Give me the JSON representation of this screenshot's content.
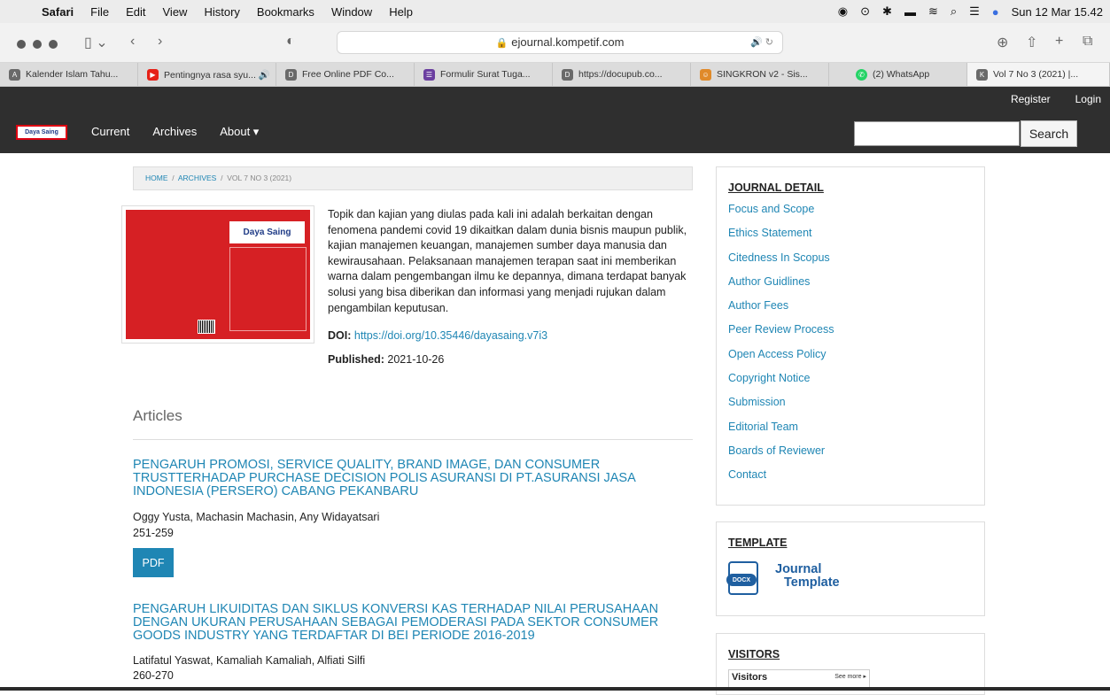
{
  "menubar": {
    "app": "Safari",
    "items": [
      "File",
      "Edit",
      "View",
      "History",
      "Bookmarks",
      "Window",
      "Help"
    ],
    "datetime": "Sun 12 Mar 15.42"
  },
  "browser": {
    "url": "ejournal.kompetif.com",
    "tabs": [
      {
        "label": "Kalender Islam Tahu...",
        "icon_color": "#6a6a6a",
        "icon": "A"
      },
      {
        "label": "Pentingnya rasa syu... 🔊",
        "icon_color": "#e62117",
        "icon": "▶"
      },
      {
        "label": "Free Online PDF Co...",
        "icon_color": "#6a6a6a",
        "icon": "D"
      },
      {
        "label": "Formulir Surat Tuga...",
        "icon_color": "#6b3fa0",
        "icon": "☰"
      },
      {
        "label": "https://docupub.co...",
        "icon_color": "#6a6a6a",
        "icon": "D"
      },
      {
        "label": "SINGKRON v2 - Sis...",
        "icon_color": "#e08a2a",
        "icon": "☺"
      },
      {
        "label": "(2) WhatsApp",
        "icon_color": "#25d366",
        "icon": "●"
      },
      {
        "label": "Vol 7 No 3 (2021) |...",
        "icon_color": "#6a6a6a",
        "icon": "K"
      }
    ]
  },
  "site": {
    "register": "Register",
    "login": "Login",
    "logo_text": "Daya Saing",
    "nav": [
      "Current",
      "Archives",
      "About ▾"
    ],
    "search_button": "Search"
  },
  "breadcrumb": {
    "home": "HOME",
    "sep": "/",
    "archives": "ARCHIVES",
    "current": "VOL 7 NO 3 (2021)"
  },
  "issue": {
    "cover_logo": "Daya Saing",
    "description": "Topik dan kajian yang diulas pada kali ini adalah berkaitan dengan fenomena pandemi covid 19 dikaitkan dalam dunia bisnis maupun publik, kajian manajemen keuangan, manajemen sumber daya manusia dan kewirausahaan. Pelaksanaan manajemen terapan saat ini memberikan warna dalam pengembangan ilmu ke depannya, dimana terdapat banyak solusi yang bisa diberikan dan informasi yang menjadi rujukan dalam pengambilan keputusan.",
    "doi_label": "DOI:",
    "doi_url": "https://doi.org/10.35446/dayasaing.v7i3",
    "published_label": "Published:",
    "published_date": "2021-10-26"
  },
  "articles": {
    "heading": "Articles",
    "items": [
      {
        "title": "PENGARUH PROMOSI, SERVICE QUALITY, BRAND IMAGE, DAN CONSUMER TRUSTTERHADAP PURCHASE DECISION POLIS ASURANSI DI PT.ASURANSI JASA INDONESIA (PERSERO) CABANG PEKANBARU",
        "authors": "Oggy Yusta, Machasin Machasin, Any Widayatsari",
        "pages": "251-259",
        "pdf": "PDF"
      },
      {
        "title": "PENGARUH LIKUIDITAS DAN SIKLUS KONVERSI KAS TERHADAP NILAI PERUSAHAAN DENGAN UKURAN PERUSAHAAN SEBAGAI PEMODERASI PADA SEKTOR CONSUMER GOODS INDUSTRY YANG TERDAFTAR DI BEI PERIODE 2016-2019",
        "authors": "Latifatul Yaswat, Kamaliah Kamaliah, Alfiati Silfi",
        "pages": "260-270"
      }
    ]
  },
  "sidebar": {
    "journal_detail": {
      "title": "JOURNAL DETAIL",
      "links": [
        "Focus and Scope",
        "Ethics Statement",
        " Citedness In Scopus",
        "Author Guidlines",
        "Author Fees",
        "Peer Review Process",
        "Open Access Policy",
        "Copyright Notice",
        "Submission",
        "Editorial Team",
        "Boards of Reviewer",
        "Contact"
      ]
    },
    "template": {
      "title": "TEMPLATE",
      "badge": "DOCX",
      "line1": "Journal",
      "line2": "Template"
    },
    "visitors": {
      "title": "VISITORS",
      "widget_title": "Visitors",
      "see_more": "See more ▸"
    }
  }
}
